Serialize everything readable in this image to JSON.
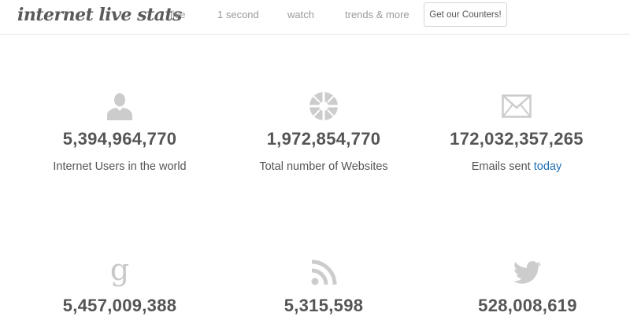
{
  "header": {
    "logo": "internet live stats",
    "nav": [
      {
        "label": "live"
      },
      {
        "label": "1 second"
      },
      {
        "label": "watch"
      },
      {
        "label": "trends & more"
      }
    ],
    "cta_label": "Get our Counters!"
  },
  "stats": [
    {
      "icon": "user-icon",
      "value": "5,394,964,770",
      "label": "Internet Users in the world"
    },
    {
      "icon": "globe-icon",
      "value": "1,972,854,770",
      "label": "Total number of Websites"
    },
    {
      "icon": "envelope-icon",
      "value": "172,032,357,265",
      "label": "Emails sent",
      "label_highlight": "today"
    },
    {
      "icon": "google-icon",
      "value": "5,457,009,388"
    },
    {
      "icon": "rss-icon",
      "value": "5,315,598"
    },
    {
      "icon": "twitter-icon",
      "value": "528,008,619"
    }
  ],
  "colors": {
    "icon": "#cccccc",
    "text": "#555555",
    "nav": "#9a9a9a",
    "link": "#1f6fb5"
  }
}
